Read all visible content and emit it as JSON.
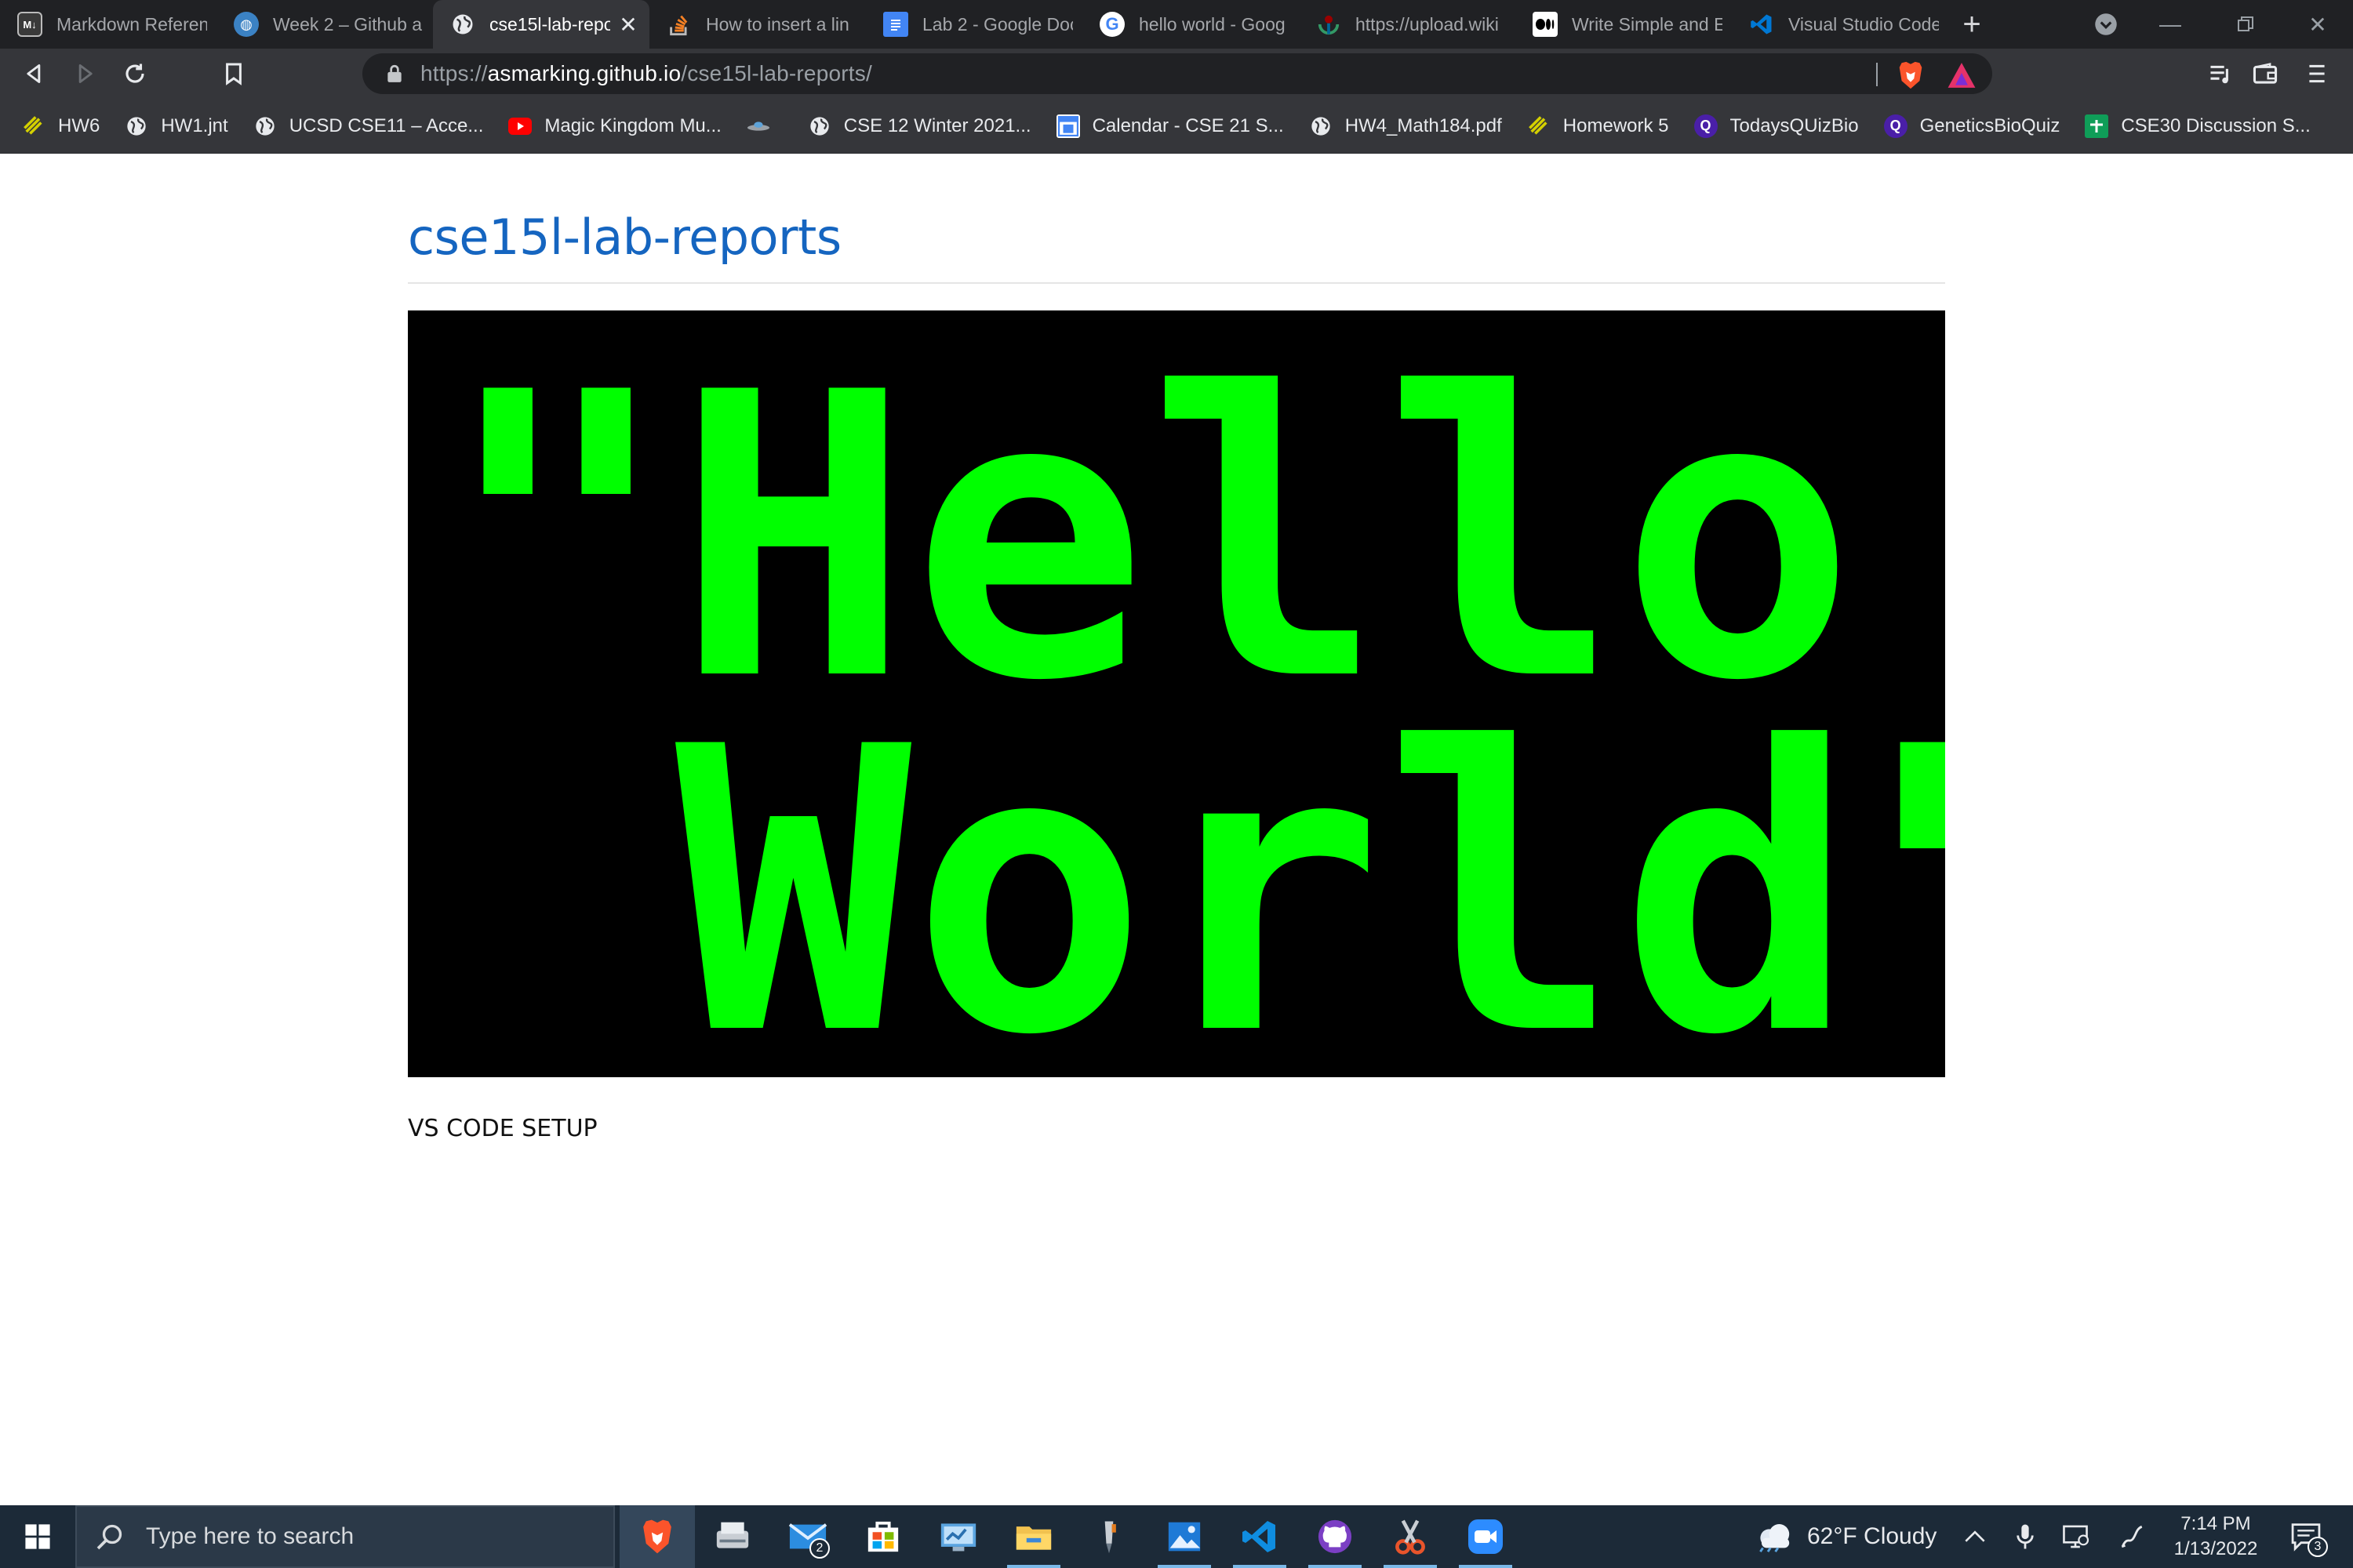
{
  "browser": {
    "tabs": [
      {
        "label": "Markdown Referen",
        "icon": "markdown-icon",
        "color": "#3a3a3a"
      },
      {
        "label": "Week 2 – Github a",
        "icon": "globe-blue-icon",
        "color": "#3b82c4"
      },
      {
        "label": "cse15l-lab-repo",
        "icon": "globe-icon",
        "color": "#5f6368",
        "active": true
      },
      {
        "label": "How to insert a lin",
        "icon": "stackoverflow-icon",
        "color": "#f48024"
      },
      {
        "label": "Lab 2 - Google Doc",
        "icon": "google-docs-icon",
        "color": "#4285f4"
      },
      {
        "label": "hello world - Goog",
        "icon": "google-icon",
        "color": "#ffffff"
      },
      {
        "label": "https://upload.wiki",
        "icon": "wikimedia-icon",
        "color": "#339966"
      },
      {
        "label": "Write Simple and E",
        "icon": "medium-icon",
        "color": "#000000"
      },
      {
        "label": "Visual Studio Code",
        "icon": "vscode-icon",
        "color": "#0078d4"
      }
    ],
    "address": {
      "prefix": "https://",
      "host": "asmarking.github.io",
      "path": "/cse15l-lab-reports/"
    },
    "bookmarks": [
      {
        "label": "HW6",
        "icon": "lightning-icon",
        "color": "#d4d000"
      },
      {
        "label": "HW1.jnt",
        "icon": "globe-icon",
        "color": "#e8eaed"
      },
      {
        "label": "UCSD CSE11 – Acce...",
        "icon": "globe-icon",
        "color": "#e8eaed"
      },
      {
        "label": "Magic Kingdom Mu...",
        "icon": "youtube-icon",
        "color": "#ff0000"
      },
      {
        "label": "",
        "icon": "ufo-icon",
        "color": "#9aa0a6"
      },
      {
        "label": "CSE 12 Winter 2021...",
        "icon": "globe-icon",
        "color": "#e8eaed"
      },
      {
        "label": "Calendar - CSE 21 S...",
        "icon": "calendar-icon",
        "color": "#4285f4"
      },
      {
        "label": "HW4_Math184.pdf",
        "icon": "globe-icon",
        "color": "#e8eaed"
      },
      {
        "label": "Homework 5",
        "icon": "lightning-icon",
        "color": "#d4d000"
      },
      {
        "label": "TodaysQUizBio",
        "icon": "quizlet-icon",
        "color": "#4a1fa8"
      },
      {
        "label": "GeneticsBioQuiz",
        "icon": "quizlet-icon",
        "color": "#4a1fa8"
      },
      {
        "label": "CSE30 Discussion S...",
        "icon": "google-sheets-icon",
        "color": "#0f9d58"
      }
    ]
  },
  "page": {
    "title": "cse15l-lab-reports",
    "hero_line1": "\"Hello",
    "hero_line2": " World\"",
    "section": "VS CODE SETUP"
  },
  "taskbar": {
    "search_placeholder": "Type here to search",
    "mail_badge": "2",
    "weather": "62°F  Cloudy",
    "time": "7:14 PM",
    "date": "1/13/2022",
    "notifications": "3"
  },
  "colors": {
    "accent_link": "#1565c0",
    "hero_text": "#00ff00",
    "hero_bg": "#000000"
  }
}
